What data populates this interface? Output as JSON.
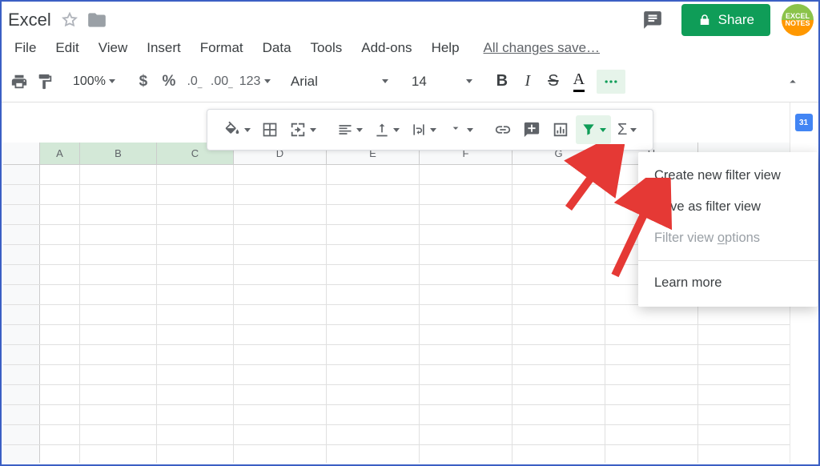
{
  "title": "Excel",
  "menu": {
    "file": "File",
    "edit": "Edit",
    "view": "View",
    "insert": "Insert",
    "format": "Format",
    "data": "Data",
    "tools": "Tools",
    "addons": "Add-ons",
    "help": "Help"
  },
  "status": "All changes save…",
  "toolbar": {
    "zoom": "100%",
    "font": "Arial",
    "font_size": "14"
  },
  "share": {
    "label": "Share"
  },
  "avatar_text": "EXCEL\nNOTES",
  "columns": [
    "A",
    "B",
    "C",
    "D",
    "E",
    "F",
    "G",
    "H"
  ],
  "filter_menu": {
    "create": "reate new filter view",
    "create_u": "C",
    "save": "Save as filter view",
    "options_pre": "Filter view ",
    "options_u": "o",
    "options_post": "ptions",
    "learn": "Learn more"
  },
  "calendar_day": "31"
}
